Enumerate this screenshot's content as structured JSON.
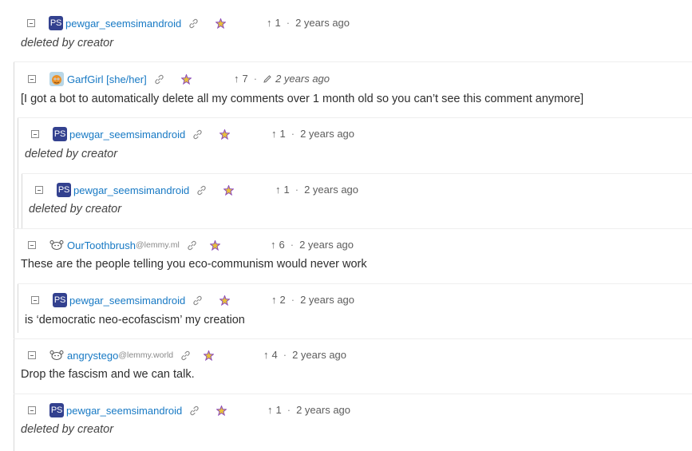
{
  "comments": [
    {
      "user": "pewgar_seemsimandroid",
      "instance": "",
      "avatar": "PS",
      "score": "1",
      "time": "2 years ago",
      "edited": false,
      "text": "deleted by creator",
      "deleted": true
    },
    {
      "user": "GarfGirl [she/her]",
      "instance": "",
      "avatar": "",
      "score": "7",
      "time": "2 years ago",
      "edited": true,
      "text": "[I got a bot to automatically delete all my comments over 1 month old so you can’t see this comment anymore]",
      "deleted": false
    },
    {
      "user": "pewgar_seemsimandroid",
      "instance": "",
      "avatar": "PS",
      "score": "1",
      "time": "2 years ago",
      "edited": false,
      "text": "deleted by creator",
      "deleted": true
    },
    {
      "user": "pewgar_seemsimandroid",
      "instance": "",
      "avatar": "PS",
      "score": "1",
      "time": "2 years ago",
      "edited": false,
      "text": "deleted by creator",
      "deleted": true
    },
    {
      "user": "OurToothbrush",
      "instance": "@lemmy.ml",
      "avatar": "",
      "score": "6",
      "time": "2 years ago",
      "edited": false,
      "text": "These are the people telling you eco-communism would never work",
      "deleted": false
    },
    {
      "user": "pewgar_seemsimandroid",
      "instance": "",
      "avatar": "PS",
      "score": "2",
      "time": "2 years ago",
      "edited": false,
      "text": "is ‘democratic neo-ecofascism’ my creation",
      "deleted": false
    },
    {
      "user": "angrystego",
      "instance": "@lemmy.world",
      "avatar": "",
      "score": "4",
      "time": "2 years ago",
      "edited": false,
      "text": "Drop the fascism and we can talk.",
      "deleted": false
    },
    {
      "user": "pewgar_seemsimandroid",
      "instance": "",
      "avatar": "PS",
      "score": "1",
      "time": "2 years ago",
      "edited": false,
      "text": "deleted by creator",
      "deleted": true
    }
  ],
  "colors": {
    "username": "#1779c4",
    "avatar_bg": "#33418f",
    "thread_line": "#d7d7d7"
  },
  "icons": {
    "collapse": "collapse-minus-icon",
    "link": "link-icon",
    "instance_badge": "rainbow-star-icon",
    "upvote": "arrow-up-icon",
    "edited": "pencil-icon",
    "bot_avatar": "mascot-icon"
  }
}
